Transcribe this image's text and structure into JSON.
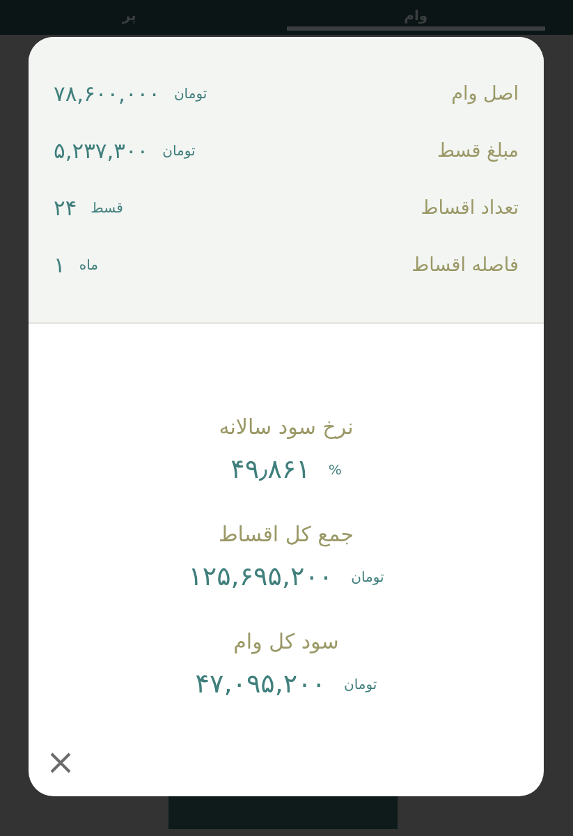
{
  "tabs": [
    {
      "label": "وام",
      "selected": true
    },
    {
      "label": "پر",
      "selected": false
    }
  ],
  "summary": [
    {
      "label": "اصل وام",
      "value": "۷۸,۶۰۰,۰۰۰",
      "unit": "تومان"
    },
    {
      "label": "مبلغ قسط",
      "value": "۵,۲۳۷,۳۰۰",
      "unit": "تومان"
    },
    {
      "label": "تعداد اقساط",
      "value": "۲۴",
      "unit": "قسط"
    },
    {
      "label": "فاصله اقساط",
      "value": "۱",
      "unit": "ماه"
    }
  ],
  "results": [
    {
      "label": "نرخ سود سالانه",
      "value": "۴۹٫۸۶۱",
      "unit": "%"
    },
    {
      "label": "جمع کل اقساط",
      "value": "۱۲۵,۶۹۵,۲۰۰",
      "unit": "تومان"
    },
    {
      "label": "سود کل وام",
      "value": "۴۷,۰۹۵,۲۰۰",
      "unit": "تومان"
    }
  ]
}
